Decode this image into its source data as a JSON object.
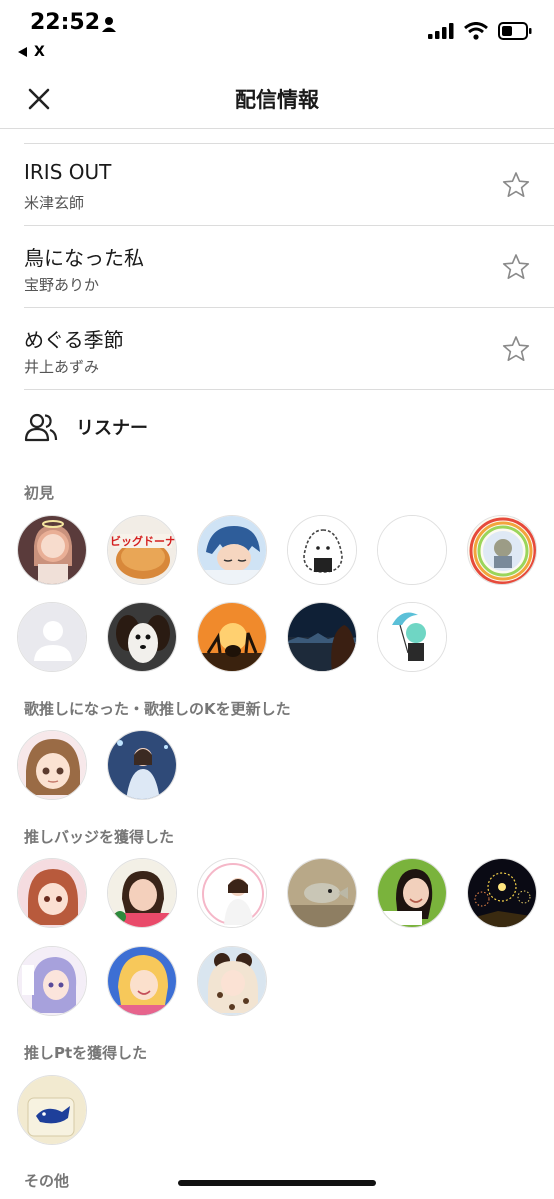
{
  "status_bar": {
    "time": "22:52",
    "back_app": "X"
  },
  "nav": {
    "title": "配信情報"
  },
  "songs": [
    {
      "title": "IRIS OUT",
      "artist": "米津玄師"
    },
    {
      "title": "鳥になった私",
      "artist": "宝野ありか"
    },
    {
      "title": "めぐる季節",
      "artist": "井上あずみ"
    }
  ],
  "listeners": {
    "title": "リスナー",
    "sections": {
      "first_visit": "初見",
      "song_oshi": "歌推しになった・歌推しのKを更新した",
      "badge": "推しバッジを獲得した",
      "pt": "推しPtを獲得した",
      "other": "その他"
    },
    "avatar_text": {
      "bread": "ビッグドーナ"
    }
  },
  "colors": {
    "accent": "#1a1a1a",
    "divider": "#dcdcdc",
    "label": "#777777"
  }
}
